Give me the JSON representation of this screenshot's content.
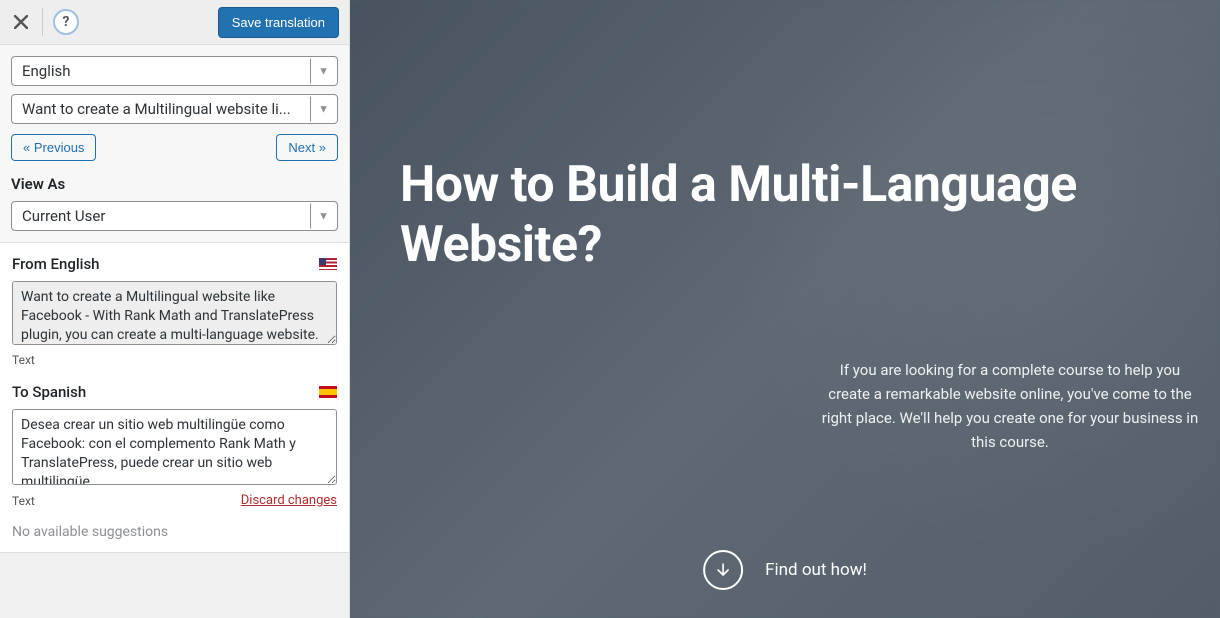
{
  "topbar": {
    "save_label": "Save translation"
  },
  "controls": {
    "language_select": "English",
    "string_select": "Want to create a Multilingual website li...",
    "prev_label": "« Previous",
    "next_label": "Next »",
    "view_as_label": "View As",
    "view_as_value": "Current User"
  },
  "translation": {
    "from_label": "From English",
    "from_text": "Want to create a Multilingual website like Facebook - With Rank Math and TranslatePress plugin, you can create a multi-language website.",
    "from_type": "Text",
    "to_label": "To Spanish",
    "to_text": "Desea crear un sitio web multilingüe como Facebook: con el complemento Rank Math y TranslatePress, puede crear un sitio web multilingüe.",
    "to_type": "Text",
    "discard_label": "Discard changes",
    "suggestions": "No available suggestions"
  },
  "preview": {
    "title": "How to Build a Multi-Language Website?",
    "description": "If you are looking for a complete course to help you create a remarkable website online, you've come to the right place. We'll help you create one for your business in this course.",
    "cta": "Find out how!"
  }
}
